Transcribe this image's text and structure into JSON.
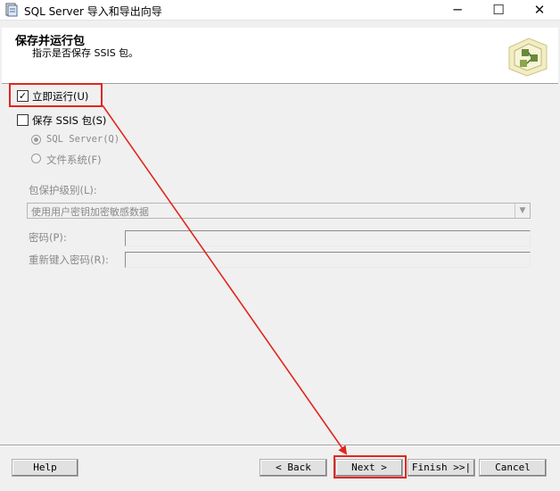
{
  "window": {
    "title": "SQL Server 导入和导出向导",
    "app_icon": "wizard-app-icon",
    "controls": {
      "minimize": "─",
      "maximize": "☐",
      "close": "✕"
    }
  },
  "header": {
    "title": "保存并运行包",
    "subtitle": "指示是否保存 SSIS 包。",
    "logo_icon": "ssis-package-icon"
  },
  "options": {
    "run_immediately": {
      "label": "立即运行(U)",
      "checked": true
    },
    "save_package": {
      "label": "保存 SSIS 包(S)",
      "checked": false
    },
    "radio_sql_server": {
      "label": "SQL Server(Q)",
      "selected": true,
      "enabled": false
    },
    "radio_file_system": {
      "label": "文件系统(F)",
      "selected": false,
      "enabled": false
    }
  },
  "protection": {
    "label": "包保护级别(L):",
    "selected_value": "使用用户密钥加密敏感数据"
  },
  "password": {
    "label": "密码(P):",
    "value": ""
  },
  "retype_password": {
    "label": "重新键入密码(R):",
    "value": ""
  },
  "buttons": {
    "help": "Help",
    "back": "< Back",
    "next": "Next >",
    "finish": "Finish >>|",
    "cancel": "Cancel"
  },
  "annotation": {
    "color": "#e0271f"
  }
}
